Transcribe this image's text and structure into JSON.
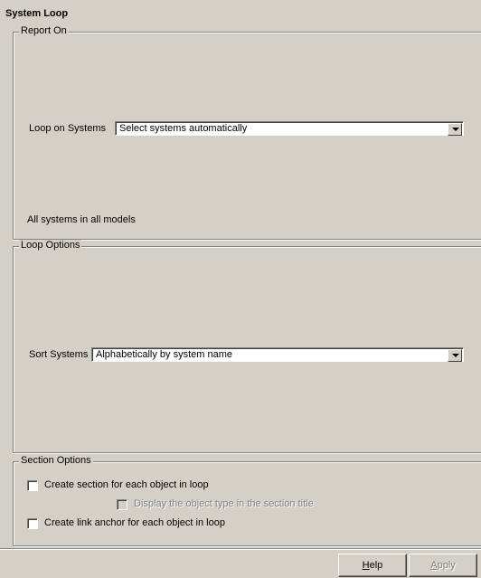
{
  "title": "System Loop",
  "report_on": {
    "legend": "Report On",
    "loop_label": "Loop on Systems",
    "loop_value": "Select systems automatically",
    "summary": "All systems in all models"
  },
  "loop_options": {
    "legend": "Loop Options",
    "sort_label": "Sort Systems",
    "sort_value": "Alphabetically by system name"
  },
  "section_options": {
    "legend": "Section Options",
    "create_section": {
      "label": "Create section for each object in loop",
      "checked": false
    },
    "display_type": {
      "label": "Display the object type in the section title",
      "checked": false,
      "enabled": false
    },
    "create_anchor": {
      "label": "Create link anchor for each object in loop",
      "checked": false
    }
  },
  "buttons": {
    "help_mnemonic": "H",
    "help_rest": "elp",
    "apply_mnemonic": "A",
    "apply_rest": "pply",
    "apply_enabled": false
  },
  "icons": [
    "dropdown-arrow-icon"
  ]
}
